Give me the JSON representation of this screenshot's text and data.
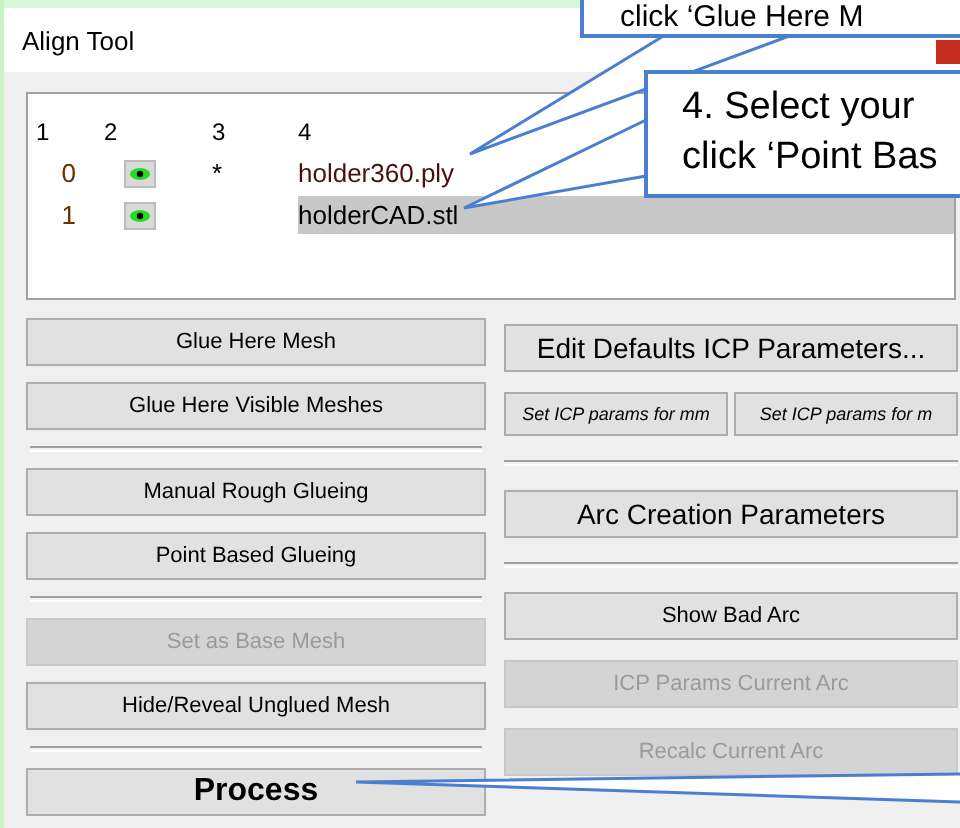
{
  "window": {
    "title": "Align Tool"
  },
  "mesh_list": {
    "columns": [
      "1",
      "2",
      "3",
      "4"
    ],
    "rows": [
      {
        "index": "0",
        "visible": true,
        "marker": "*",
        "name": "holder360.ply",
        "selected": false
      },
      {
        "index": "1",
        "visible": true,
        "marker": "",
        "name": "holderCAD.stl",
        "selected": true
      }
    ]
  },
  "left_buttons": [
    {
      "label": "Glue Here Mesh",
      "disabled": false,
      "kind": "normal",
      "separator_after": false
    },
    {
      "label": "Glue Here Visible Meshes",
      "disabled": false,
      "kind": "normal",
      "separator_after": true
    },
    {
      "label": "Manual Rough Glueing",
      "disabled": false,
      "kind": "normal",
      "separator_after": false
    },
    {
      "label": "Point Based Glueing",
      "disabled": false,
      "kind": "normal",
      "separator_after": true
    },
    {
      "label": "Set as Base Mesh",
      "disabled": true,
      "kind": "normal",
      "separator_after": false
    },
    {
      "label": "Hide/Reveal Unglued Mesh",
      "disabled": false,
      "kind": "normal",
      "separator_after": true
    },
    {
      "label": "Process",
      "disabled": false,
      "kind": "large",
      "separator_after": false
    }
  ],
  "right_buttons": [
    {
      "kind": "wide",
      "labels": [
        "Edit Defaults ICP Parameters..."
      ],
      "disabled": false,
      "separator_after": false
    },
    {
      "kind": "pair",
      "labels": [
        "Set ICP params for mm",
        "Set ICP params for m"
      ],
      "disabled": false,
      "separator_after": true
    },
    {
      "kind": "wide",
      "labels": [
        "Arc Creation Parameters"
      ],
      "disabled": false,
      "separator_after": true
    },
    {
      "kind": "normal",
      "labels": [
        "Show Bad Arc"
      ],
      "disabled": false,
      "separator_after": false
    },
    {
      "kind": "normal",
      "labels": [
        "ICP Params Current Arc"
      ],
      "disabled": true,
      "separator_after": false
    },
    {
      "kind": "normal",
      "labels": [
        "Recalc Current Arc"
      ],
      "disabled": true,
      "separator_after": false
    }
  ],
  "callouts": [
    {
      "lines": [
        "click ‘Glue Here M"
      ]
    },
    {
      "lines": [
        "4. Select your",
        "click ‘Point Bas"
      ]
    }
  ]
}
